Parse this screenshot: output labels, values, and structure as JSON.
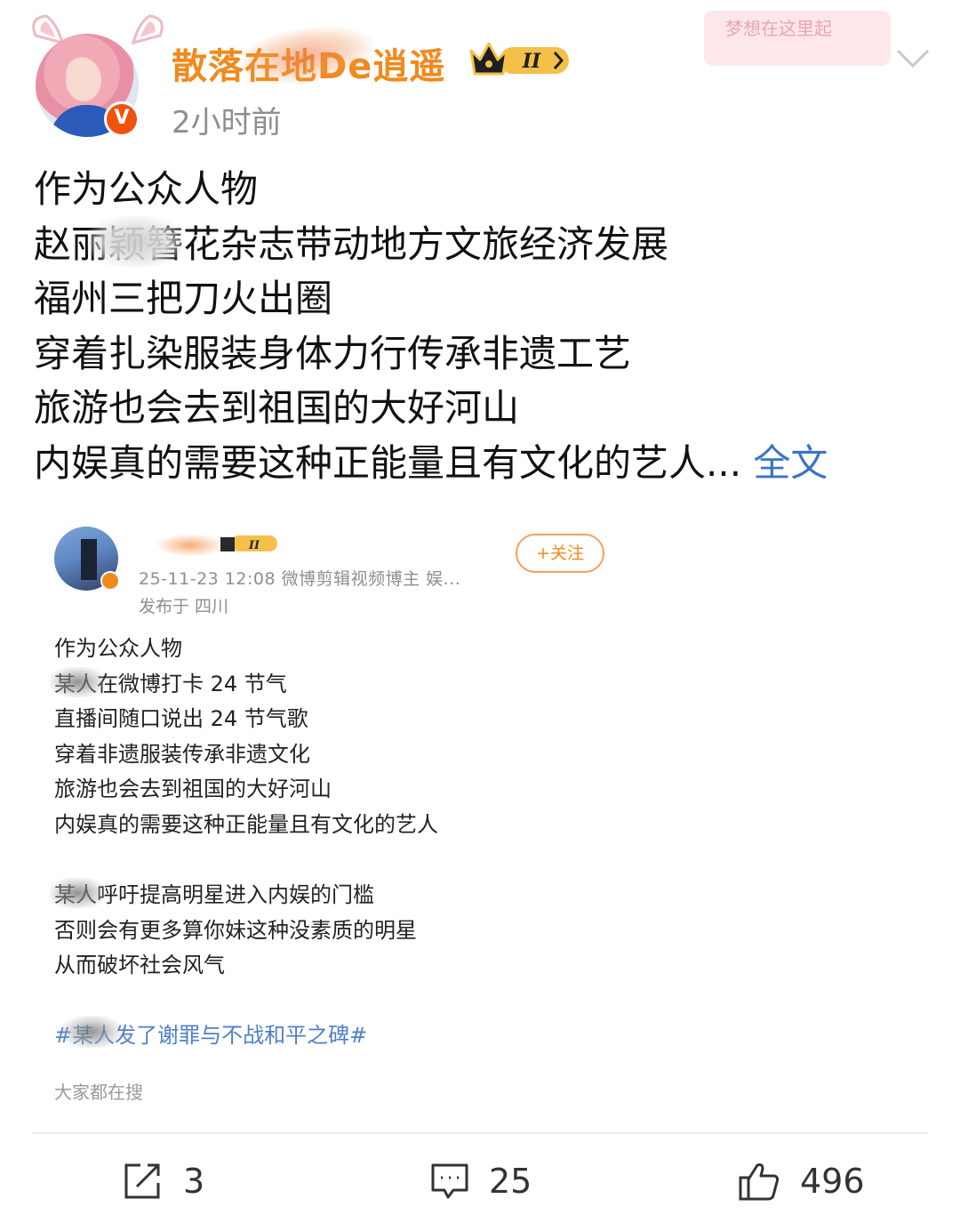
{
  "header": {
    "username": "散落在地De逍遥",
    "level_badge": "II",
    "timestamp": "2小时前",
    "corner_tag_text": "梦想在这里起"
  },
  "post": {
    "lines": [
      "作为公众人物",
      "赵丽颖簪花杂志带动地方文旅经济发展",
      "福州三把刀火出圈",
      "穿着扎染服装身体力行传承非遗工艺",
      "旅游也会去到祖国的大好河山",
      "内娱真的需要这种正能量且有文化的艺人..."
    ],
    "full_text_link": "全文"
  },
  "embedded": {
    "level_badge": "II",
    "meta_line1": "25-11-23 12:08  微博剪辑视频博主 娱...",
    "meta_line2": "发布于 四川",
    "follow_label": "+关注",
    "body_lines": [
      "作为公众人物",
      "某人在微博打卡 24 节气",
      "直播间随口说出 24 节气歌",
      "穿着非遗服装传承非遗文化",
      "旅游也会去到祖国的大好河山",
      "内娱真的需要这种正能量且有文化的艺人",
      "",
      "某人呼吁提高明星进入内娱的门槛",
      "否则会有更多算你妹这种没素质的明星",
      "从而破坏社会风气"
    ],
    "hashtag": "#某人发了谢罪与不战和平之碑#",
    "searching_label": "大家都在搜"
  },
  "actions": {
    "repost_count": "3",
    "comment_count": "25",
    "like_count": "496"
  },
  "colors": {
    "username": "#f08a1d",
    "link_blue": "#3a74c7",
    "hashtag_blue": "#4f7fc8",
    "verified_badge": "#f0530e",
    "meta_gray": "#8e8e8e"
  },
  "icons": {
    "repost": "repost-icon",
    "comment": "comment-icon",
    "like": "like-icon",
    "chevron": "chevron-down-icon",
    "crown": "crown-icon"
  }
}
